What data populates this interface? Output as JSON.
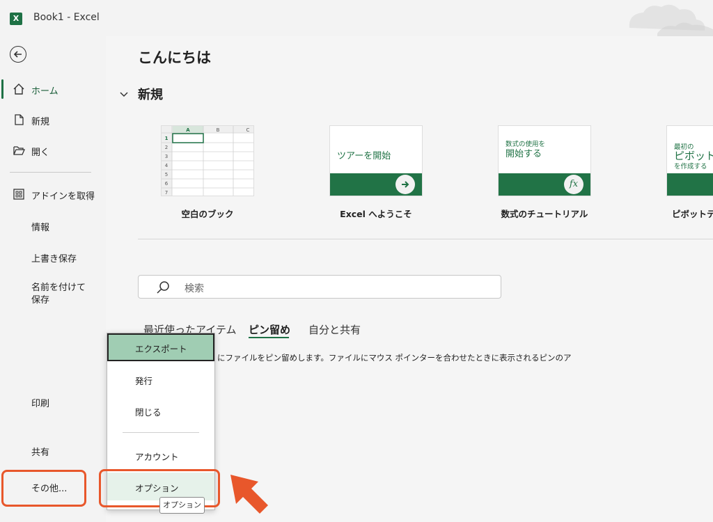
{
  "window": {
    "title": "Book1  -  Excel",
    "app_icon_letter": "X"
  },
  "sidebar": {
    "items": [
      {
        "label": "ホーム"
      },
      {
        "label": "新規"
      },
      {
        "label": "開く"
      },
      {
        "label": "アドインを取得"
      },
      {
        "label": "情報"
      },
      {
        "label": "上書き保存"
      },
      {
        "label": "名前を付けて保存"
      },
      {
        "label": "印刷"
      },
      {
        "label": "共有"
      },
      {
        "label": "その他..."
      }
    ]
  },
  "main": {
    "greeting": "こんにちは",
    "new_section": "新規",
    "templates": [
      {
        "caption": "空白のブック",
        "col_headers": [
          "A",
          "B",
          "C"
        ],
        "row_numbers": [
          "1",
          "2",
          "3",
          "4",
          "5",
          "6",
          "7"
        ]
      },
      {
        "caption": "Excel へようこそ",
        "thumb_text": "ツアーを開始"
      },
      {
        "caption": "数式のチュートリアル",
        "thumb_small": "数式の使用を",
        "thumb_big": "開始する",
        "icon_text": "fx"
      },
      {
        "caption": "ピボットテー",
        "thumb_small": "最初の",
        "thumb_big": "ピボットテ",
        "thumb_small2": "を作成する"
      }
    ],
    "search_placeholder": "検索",
    "tabs": [
      {
        "label": "最近使ったアイテム"
      },
      {
        "label": "ピン留め"
      },
      {
        "label": "自分と共有"
      }
    ],
    "pin_message": "にファイルをピン留めします。ファイルにマウス ポインターを合わせたときに表示されるピンのア"
  },
  "popup_menu": {
    "items": [
      {
        "label": "エクスポート"
      },
      {
        "label": "発行"
      },
      {
        "label": "閉じる"
      },
      {
        "label": "アカウント"
      },
      {
        "label": "オプション"
      }
    ],
    "tooltip": "オプション"
  },
  "colors": {
    "accent": "#1e7145",
    "callout": "#e8572b",
    "highlight": "#a0cdb3"
  }
}
